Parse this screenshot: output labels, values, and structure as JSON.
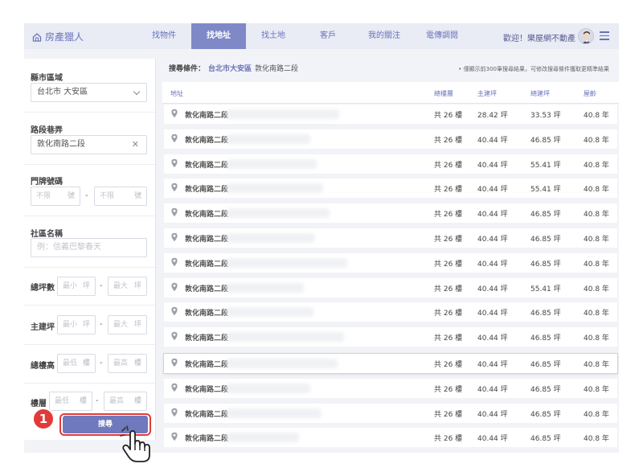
{
  "header": {
    "logo": "房產獵人",
    "nav": [
      "找物件",
      "找地址",
      "找土地",
      "客戶",
      "我的關注",
      "電傳調閱"
    ],
    "active_nav": "找地址",
    "welcome": "歡迎！樂屋網不動產"
  },
  "sidebar": {
    "county_label": "縣市區域",
    "county_value": "台北市 大安區",
    "road_label": "路段巷弄",
    "road_value": "敦化南路二段",
    "door_label": "門牌號碼",
    "door_from_placeholder": "不限",
    "door_to_placeholder": "不限",
    "door_unit": "號",
    "community_label": "社區名稱",
    "community_placeholder": "例：信義巴黎春天",
    "total_ping_label": "總坪數",
    "main_ping_label": "主建坪",
    "min_placeholder": "最小",
    "max_placeholder": "最大",
    "ping_unit": "坪",
    "total_floor_label": "總樓高",
    "floor_label": "樓層",
    "low_placeholder": "最低",
    "high_placeholder": "最高",
    "floor_unit": "樓",
    "dash": "-",
    "search_button": "搜尋",
    "step_number": "1"
  },
  "results": {
    "criteria_label": "搜尋條件：",
    "criteria_area": "台北市大安區",
    "criteria_road": "敦化南路二段",
    "note": "• 僅顯示前300筆搜尋結果，可修改搜尋條件獲取更精準結果",
    "columns": {
      "address": "地址",
      "total_floors": "總樓層",
      "main_ping": "主建坪",
      "total_ping": "總建坪",
      "age": "屋齡"
    },
    "rows": [
      {
        "address": "敦化南路二段",
        "floors": "共 26 樓",
        "main": "28.42 坪",
        "total": "33.53 坪",
        "age": "40.8 年"
      },
      {
        "address": "敦化南路二段",
        "floors": "共 26 樓",
        "main": "40.44 坪",
        "total": "46.85 坪",
        "age": "40.8 年"
      },
      {
        "address": "敦化南路二段",
        "floors": "共 26 樓",
        "main": "40.44 坪",
        "total": "55.41 坪",
        "age": "40.8 年"
      },
      {
        "address": "敦化南路二段",
        "floors": "共 26 樓",
        "main": "40.44 坪",
        "total": "55.41 坪",
        "age": "40.8 年"
      },
      {
        "address": "敦化南路二段",
        "floors": "共 26 樓",
        "main": "40.44 坪",
        "total": "46.85 坪",
        "age": "40.8 年"
      },
      {
        "address": "敦化南路二段",
        "floors": "共 26 樓",
        "main": "40.44 坪",
        "total": "46.85 坪",
        "age": "40.8 年"
      },
      {
        "address": "敦化南路二段",
        "floors": "共 26 樓",
        "main": "40.44 坪",
        "total": "46.85 坪",
        "age": "40.8 年"
      },
      {
        "address": "敦化南路二段",
        "floors": "共 26 樓",
        "main": "40.44 坪",
        "total": "55.41 坪",
        "age": "40.8 年"
      },
      {
        "address": "敦化南路二段",
        "floors": "共 26 樓",
        "main": "40.44 坪",
        "total": "46.85 坪",
        "age": "40.8 年"
      },
      {
        "address": "敦化南路二段",
        "floors": "共 26 樓",
        "main": "40.44 坪",
        "total": "46.85 坪",
        "age": "40.8 年"
      },
      {
        "address": "敦化南路二段",
        "floors": "共 26 樓",
        "main": "40.44 坪",
        "total": "46.85 坪",
        "age": "40.8 年"
      },
      {
        "address": "敦化南路二段",
        "floors": "共 26 樓",
        "main": "40.44 坪",
        "total": "46.85 坪",
        "age": "40.8 年"
      },
      {
        "address": "敦化南路二段",
        "floors": "共 26 樓",
        "main": "40.44 坪",
        "total": "46.85 坪",
        "age": "40.8 年"
      },
      {
        "address": "敦化南路二段",
        "floors": "共 26 樓",
        "main": "40.44 坪",
        "total": "46.85 坪",
        "age": "40.8 年"
      }
    ],
    "highlighted_row": 10
  },
  "colors": {
    "accent": "#6f79bd",
    "header_bg": "#e9ebf5",
    "highlight_red": "#e23a3a"
  },
  "icons": [
    "house-icon",
    "avatar",
    "menu-icon",
    "chevron-down-icon",
    "clear-icon",
    "map-pin-icon",
    "hand-pointer-icon"
  ]
}
